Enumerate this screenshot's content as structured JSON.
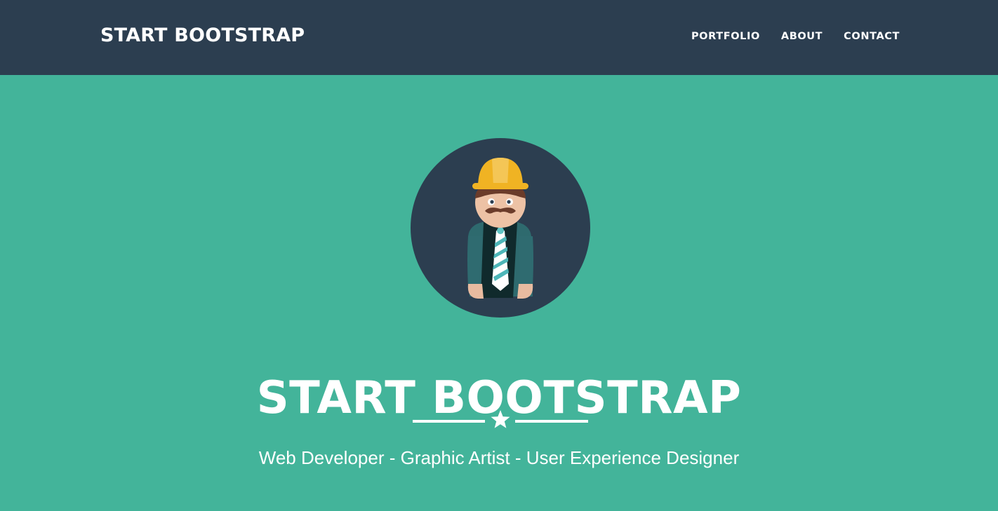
{
  "navbar": {
    "brand": "START BOOTSTRAP",
    "links": [
      "PORTFOLIO",
      "ABOUT",
      "CONTACT"
    ],
    "background": "#2c3e50"
  },
  "hero": {
    "background": "#43b49a",
    "avatar_icon": "construction-worker-avatar-icon",
    "title": "START BOOTSTRAP",
    "divider_icon": "star-icon",
    "subtitle": "Web Developer - Graphic Artist - User Experience Designer"
  }
}
